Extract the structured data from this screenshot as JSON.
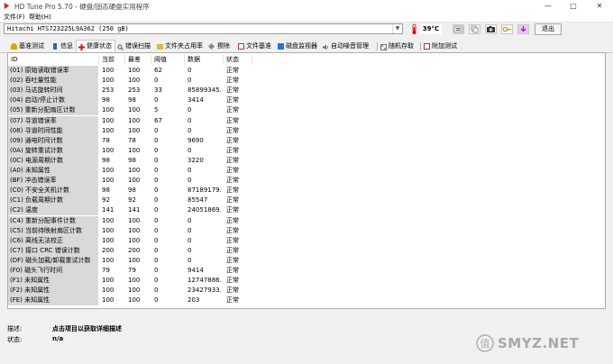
{
  "window": {
    "title": "HD Tune Pro 5.70 - 硬盘/固态硬盘实用程序",
    "min_glyph": "—",
    "max_glyph": "□",
    "close_glyph": "✕"
  },
  "menu": {
    "file": "文件(F)",
    "help": "帮助(H)"
  },
  "toolbar": {
    "drive": "Hitachi HTS723225L9A362 (250 gB)",
    "temperature": "39°C",
    "exit_label": "退出",
    "icons": [
      "info-icon",
      "copy-icon",
      "camera-icon",
      "key-icon",
      "download-icon"
    ]
  },
  "tabs": [
    {
      "label": "基准测试",
      "icon": "benchmark-icon",
      "color": "#c8a000"
    },
    {
      "label": "信息",
      "icon": "info-icon",
      "color": "#2266aa"
    },
    {
      "label": "健康状态",
      "icon": "health-icon",
      "color": "#cc1111",
      "active": true
    },
    {
      "label": "错误扫描",
      "icon": "error-scan-icon",
      "color": "#2a6e2a"
    },
    {
      "label": "文件夹占用率",
      "icon": "folder-icon",
      "color": "#e0b030"
    },
    {
      "label": "擦除",
      "icon": "erase-icon",
      "color": "#777777"
    },
    {
      "label": "文件基准",
      "icon": "file-benchmark-icon",
      "color": "#bb3333"
    },
    {
      "label": "磁盘监视器",
      "icon": "monitor-icon",
      "color": "#2277cc"
    },
    {
      "label": "自动噪音管理",
      "icon": "aam-icon",
      "color": "#666666"
    },
    {
      "label": "随机存取",
      "icon": "random-access-icon",
      "color": "#444444"
    },
    {
      "label": "附加测试",
      "icon": "extra-tests-icon",
      "color": "#aa3333"
    }
  ],
  "table": {
    "headers": {
      "id": "ID",
      "current": "当前",
      "worst": "最差",
      "threshold": "阈值",
      "data": "数据",
      "status": "状态"
    },
    "rows": [
      {
        "id": "(01) 原始读取错误率",
        "current": "100",
        "worst": "100",
        "threshold": "62",
        "data": "0",
        "status": "正常"
      },
      {
        "id": "(02) 吞吐量性能",
        "current": "100",
        "worst": "100",
        "threshold": "0",
        "data": "0",
        "status": "正常"
      },
      {
        "id": "(03) 马达旋转时间",
        "current": "253",
        "worst": "253",
        "threshold": "33",
        "data": "85899345...",
        "status": "正常"
      },
      {
        "id": "(04) 启动/停止计数",
        "current": "98",
        "worst": "98",
        "threshold": "0",
        "data": "3414",
        "status": "正常"
      },
      {
        "id": "(05) 重新分配扇区计数",
        "current": "100",
        "worst": "100",
        "threshold": "5",
        "data": "0",
        "status": "正常"
      },
      {
        "id": "(07) 寻道错误率",
        "current": "100",
        "worst": "100",
        "threshold": "67",
        "data": "0",
        "status": "正常"
      },
      {
        "id": "(08) 寻道时间性能",
        "current": "100",
        "worst": "100",
        "threshold": "0",
        "data": "0",
        "status": "正常"
      },
      {
        "id": "(09) 通电时间计数",
        "current": "78",
        "worst": "78",
        "threshold": "0",
        "data": "9690",
        "status": "正常"
      },
      {
        "id": "(0A) 旋转重试计数",
        "current": "100",
        "worst": "100",
        "threshold": "0",
        "data": "0",
        "status": "正常"
      },
      {
        "id": "(0C) 电源周期计数",
        "current": "98",
        "worst": "98",
        "threshold": "0",
        "data": "3220",
        "status": "正常"
      },
      {
        "id": "(A0) 未知属性",
        "current": "100",
        "worst": "100",
        "threshold": "0",
        "data": "0",
        "status": "正常"
      },
      {
        "id": "(BF) 冲击错误率",
        "current": "100",
        "worst": "100",
        "threshold": "0",
        "data": "0",
        "status": "正常"
      },
      {
        "id": "(C0) 不安全关机计数",
        "current": "98",
        "worst": "98",
        "threshold": "0",
        "data": "87189179...",
        "status": "正常"
      },
      {
        "id": "(C1) 负载周期计数",
        "current": "92",
        "worst": "92",
        "threshold": "0",
        "data": "85547",
        "status": "正常"
      },
      {
        "id": "(C2) 温度",
        "current": "141",
        "worst": "141",
        "threshold": "0",
        "data": "24051869...",
        "status": "正常"
      },
      {
        "id": "(C4) 重新分配事件计数",
        "current": "100",
        "worst": "100",
        "threshold": "0",
        "data": "0",
        "status": "正常"
      },
      {
        "id": "(C5) 当前待映射扇区计数",
        "current": "100",
        "worst": "100",
        "threshold": "0",
        "data": "0",
        "status": "正常"
      },
      {
        "id": "(C6) 离线无法校正",
        "current": "100",
        "worst": "100",
        "threshold": "0",
        "data": "0",
        "status": "正常"
      },
      {
        "id": "(C7) 接口 CRC 错误计数",
        "current": "200",
        "worst": "200",
        "threshold": "0",
        "data": "0",
        "status": "正常"
      },
      {
        "id": "(DF) 磁头加载/卸载重试计数",
        "current": "100",
        "worst": "100",
        "threshold": "0",
        "data": "0",
        "status": "正常"
      },
      {
        "id": "(F0) 磁头飞行时间",
        "current": "79",
        "worst": "79",
        "threshold": "0",
        "data": "9414",
        "status": "正常"
      },
      {
        "id": "(F1) 未知属性",
        "current": "100",
        "worst": "100",
        "threshold": "0",
        "data": "12747886...",
        "status": "正常"
      },
      {
        "id": "(F2) 未知属性",
        "current": "100",
        "worst": "100",
        "threshold": "0",
        "data": "23427933...",
        "status": "正常"
      },
      {
        "id": "(FE) 未知属性",
        "current": "100",
        "worst": "100",
        "threshold": "0",
        "data": "203",
        "status": "正常"
      }
    ]
  },
  "footer": {
    "description_label": "描述:",
    "description_value": "点击项目以获取详细描述",
    "status_label": "状态:",
    "status_value": "n/a"
  },
  "watermark": "SMYZ.NET",
  "watermark_icon": "smyz-logo-icon"
}
